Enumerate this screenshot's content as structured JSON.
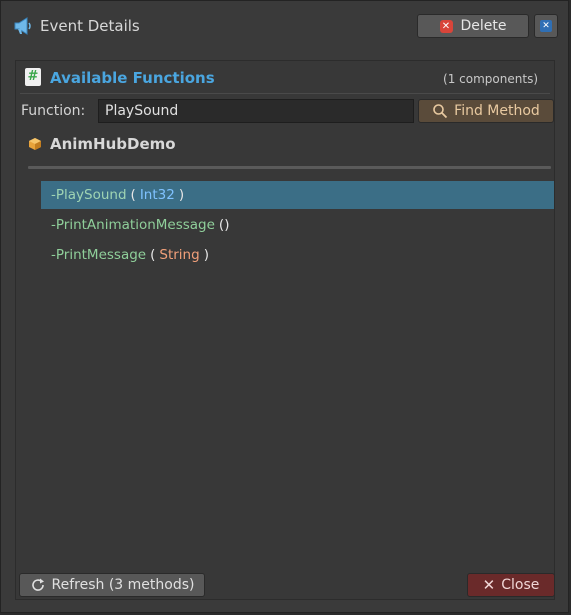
{
  "window": {
    "title": "Event Details",
    "title_icon": "megaphone-icon"
  },
  "toolbar": {
    "delete_label": "Delete",
    "close_icon": "close-icon"
  },
  "section": {
    "title": "Available Functions",
    "components_count": "(1 components)"
  },
  "search": {
    "label": "Function:",
    "value": "PlaySound",
    "find_label": "Find Method"
  },
  "component": {
    "name": "AnimHubDemo"
  },
  "methods": [
    {
      "prefix": "- ",
      "name": "PlaySound",
      "open": "(",
      "param": "Int32",
      "param_type": "int",
      "close": ")",
      "selected": true
    },
    {
      "prefix": "- ",
      "name": "PrintAnimationMessage",
      "open": "(",
      "param": "",
      "param_type": "",
      "close": ")",
      "selected": false
    },
    {
      "prefix": "- ",
      "name": "PrintMessage",
      "open": "(",
      "param": "String",
      "param_type": "string",
      "close": ")",
      "selected": false
    }
  ],
  "footer": {
    "refresh_label": "Refresh (3 methods)",
    "close_label": "Close"
  },
  "colors": {
    "accent": "#4aa6e0",
    "selection": "#3b6e86",
    "danger": "#6a2a2a",
    "method_text": "#8fcf9a"
  }
}
